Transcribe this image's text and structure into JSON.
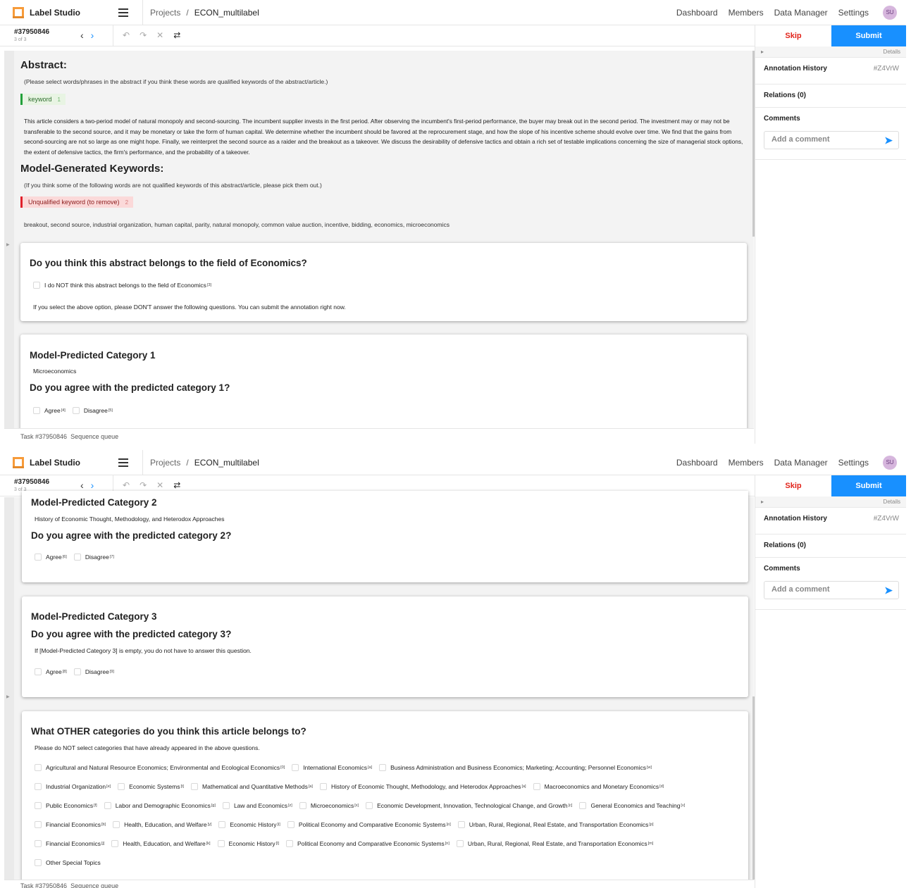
{
  "app": {
    "name": "Label Studio",
    "avatar": "SU"
  },
  "breadcrumb": {
    "root": "Projects",
    "separator": "/",
    "project": "ECON_multilabel"
  },
  "nav": [
    "Dashboard",
    "Members",
    "Data Manager",
    "Settings"
  ],
  "toolbar": {
    "task_id": "#37950846",
    "task_count": "3 of 3"
  },
  "right_panel": {
    "skip": "Skip",
    "submit": "Submit",
    "details": "Details",
    "annotation_history": "Annotation History",
    "annotation_id": "#Z4VrW",
    "relations": "Relations (0)",
    "comments": "Comments",
    "comment_placeholder": "Add a comment"
  },
  "footer": {
    "task": "Task #37950846",
    "queue": "Sequence queue"
  },
  "abstract": {
    "heading": "Abstract:",
    "instruction": "(Please select words/phrases in the abstract if you think these words are qualified keywords of the abstract/article.)",
    "label": "keyword",
    "label_hotkey": "1",
    "text": "This article considers a two-period model of natural monopoly and second-sourcing. The incumbent supplier invests in the first period. After observing the incumbent's first-period performance, the buyer may break out in the second period. The investment may or may not be transferable to the second source, and it may be monetary or take the form of human capital. We determine whether the incumbent should be favored at the reprocurement stage, and how the slope of his incentive scheme should evolve over time. We find that the gains from second-sourcing are not so large as one might hope. Finally, we reinterpret the second source as a raider and the breakout as a takeover. We discuss the desirability of defensive tactics and obtain a rich set of testable implications concerning the size of managerial stock options, the extent of defensive tactics, the firm's performance, and the probability of a takeover."
  },
  "keywords": {
    "heading": "Model-Generated Keywords:",
    "instruction": "(If you think some of the following words are not qualified keywords of this abstract/article, please pick them out.)",
    "label": "Unqualified keyword (to remove)",
    "label_hotkey": "2",
    "list": "breakout, second source, industrial organization, human capital, parity, natural monopoly, common value auction, incentive, bidding, economics, microeconomics"
  },
  "economics_card": {
    "title": "Do you think this abstract belongs to the field of Economics?",
    "option": "I do NOT think this abstract belongs to the field of Economics",
    "option_hotkey": "[3]",
    "note": "If you select the above option, please DON'T answer the following questions. You can submit the annotation right now."
  },
  "cat1": {
    "title": "Model-Predicted Category 1",
    "value": "Microeconomics",
    "question": "Do you agree with the predicted category 1?",
    "agree": "Agree",
    "agree_hotkey": "[4]",
    "disagree": "Disagree",
    "disagree_hotkey": "[5]"
  },
  "cat2": {
    "title": "Model-Predicted Category 2",
    "value": "History of Economic Thought, Methodology, and Heterodox Approaches",
    "question": "Do you agree with the predicted category 2?",
    "agree": "Agree",
    "agree_hotkey": "[6]",
    "disagree": "Disagree",
    "disagree_hotkey": "[7]"
  },
  "cat3": {
    "title": "Model-Predicted Category 3",
    "question": "Do you agree with the predicted category 3?",
    "note": "If [Model-Predicted Category 3] is empty, you do not have to answer this question.",
    "agree": "Agree",
    "agree_hotkey": "[8]",
    "disagree": "Disagree",
    "disagree_hotkey": "[9]"
  },
  "other": {
    "title": "What OTHER categories do you think this article belongs to?",
    "note": "Please do NOT select categories that have already appeared in the above questions.",
    "rows": [
      [
        {
          "label": "Agricultural and Natural Resource Economics; Environmental and Ecological Economics",
          "hk": "[0]"
        },
        {
          "label": "International Economics",
          "hk": "[a]"
        },
        {
          "label": "Business Administration and Business Economics; Marketing; Accounting; Personnel Economics",
          "hk": "[w]"
        }
      ],
      [
        {
          "label": "Industrial Organization",
          "hk": "[e]"
        },
        {
          "label": "Economic Systems",
          "hk": "[t]"
        },
        {
          "label": "Mathematical and Quantitative Methods",
          "hk": "[a]"
        },
        {
          "label": "History of Economic Thought, Methodology, and Heterodox Approaches",
          "hk": "[a]"
        },
        {
          "label": "Macroeconomics and Monetary Economics",
          "hk": "[d]"
        }
      ],
      [
        {
          "label": "Public Economics",
          "hk": "[f]"
        },
        {
          "label": "Labor and Demographic Economics",
          "hk": "[g]"
        },
        {
          "label": "Law and Economics",
          "hk": "[z]"
        },
        {
          "label": "Microeconomics",
          "hk": "[x]"
        },
        {
          "label": "Economic Development, Innovation, Technological Change, and Growth",
          "hk": "[c]"
        },
        {
          "label": "General Economics and Teaching",
          "hk": "[v]"
        }
      ],
      [
        {
          "label": "Financial Economics",
          "hk": "[b]"
        },
        {
          "label": "Health, Education, and Welfare",
          "hk": "[y]"
        },
        {
          "label": "Economic History",
          "hk": "[i]"
        },
        {
          "label": "Political Economy and Comparative Economic Systems",
          "hk": "[o]"
        },
        {
          "label": "Urban, Rural, Regional, Real Estate, and Transportation Economics",
          "hk": "[p]"
        }
      ],
      [
        {
          "label": "Financial Economics",
          "hk": "[j]"
        },
        {
          "label": "Health, Education, and Welfare",
          "hk": "[k]"
        },
        {
          "label": "Economic History",
          "hk": "[l]"
        },
        {
          "label": "Political Economy and Comparative Economic Systems",
          "hk": "[n]"
        },
        {
          "label": "Urban, Rural, Regional, Real Estate, and Transportation Economics",
          "hk": "[m]"
        }
      ],
      [
        {
          "label": "Other Special Topics",
          "hk": ""
        }
      ]
    ]
  }
}
